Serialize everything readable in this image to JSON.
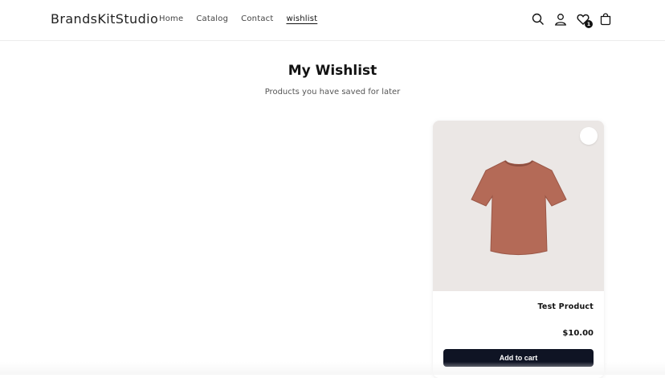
{
  "header": {
    "logo": "BrandsKitStudio",
    "nav": [
      {
        "label": "Home"
      },
      {
        "label": "Catalog"
      },
      {
        "label": "Contact"
      },
      {
        "label": "wishlist"
      }
    ],
    "icons": [
      "search-icon",
      "account-icon",
      "wishlist-icon",
      "cart-icon"
    ],
    "wishlist_count": "1"
  },
  "page": {
    "title": "My Wishlist",
    "subtitle": "Products you have saved for later"
  },
  "products": [
    {
      "title": "Test Product",
      "price": "$10.00",
      "add_to_cart_label": "Add to cart",
      "image_icon": "tshirt-icon",
      "shirt_color": "#b46a57",
      "wishlisted": true
    }
  ],
  "colors": {
    "accent": "#0f1424",
    "heart": "#a9685a",
    "media_bg": "#ebe7e5"
  }
}
